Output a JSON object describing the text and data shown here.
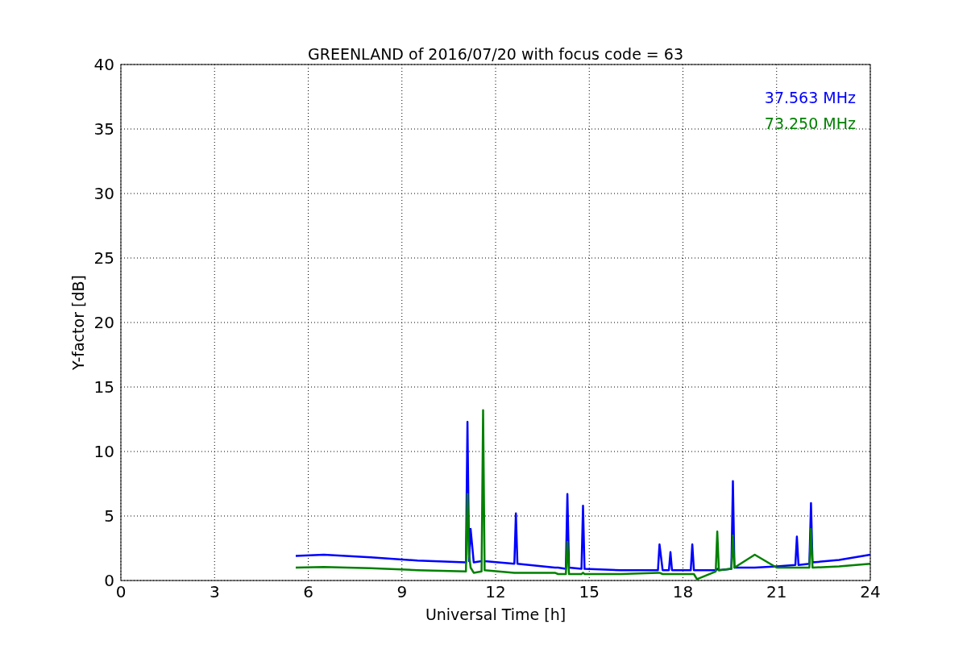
{
  "chart_data": {
    "type": "line",
    "title": "GREENLAND of 2016/07/20 with focus code = 63",
    "xlabel": "Universal Time [h]",
    "ylabel": "Y-factor [dB]",
    "xlim": [
      0,
      24
    ],
    "ylim": [
      0,
      40
    ],
    "xticks": [
      0,
      3,
      6,
      9,
      12,
      15,
      18,
      21,
      24
    ],
    "yticks": [
      0,
      5,
      10,
      15,
      20,
      25,
      30,
      35,
      40
    ],
    "grid": true,
    "x": [
      5.6,
      6.5,
      8.0,
      9.5,
      11.05,
      11.1,
      11.15,
      11.2,
      11.3,
      11.55,
      11.6,
      11.65,
      12.6,
      12.65,
      12.7,
      13.9,
      14.0,
      14.25,
      14.3,
      14.35,
      14.75,
      14.8,
      14.85,
      16,
      17.2,
      17.25,
      17.35,
      17.55,
      17.6,
      17.65,
      18.25,
      18.3,
      18.35,
      18.45,
      19.05,
      19.1,
      19.15,
      19.55,
      19.6,
      19.65,
      20.3,
      21.0,
      21.6,
      21.65,
      21.7,
      22.05,
      22.1,
      22.15,
      23,
      24
    ],
    "series": [
      {
        "name": "37.563 MHz",
        "color": "#0000ff",
        "values": [
          1.9,
          2.0,
          1.8,
          1.55,
          1.4,
          12.3,
          1.5,
          4.0,
          1.4,
          1.5,
          null,
          1.5,
          1.3,
          5.2,
          1.3,
          1.0,
          1.0,
          0.9,
          6.7,
          1.0,
          0.9,
          5.8,
          0.9,
          0.8,
          0.8,
          2.8,
          0.8,
          0.8,
          2.2,
          0.8,
          0.8,
          2.8,
          0.8,
          0.8,
          0.8,
          0.9,
          0.8,
          0.9,
          7.7,
          1.0,
          1.0,
          1.1,
          1.2,
          3.4,
          1.2,
          1.3,
          6.0,
          1.4,
          1.6,
          2.0
        ]
      },
      {
        "name": "73.250 MHz",
        "color": "#008000",
        "values": [
          1.0,
          1.05,
          0.95,
          0.8,
          0.7,
          6.7,
          2.0,
          1.0,
          0.6,
          0.7,
          13.2,
          0.8,
          0.6,
          0.6,
          0.6,
          0.6,
          0.5,
          0.5,
          3.0,
          0.5,
          0.5,
          0.6,
          0.5,
          0.5,
          0.6,
          0.6,
          0.5,
          0.5,
          0.5,
          0.5,
          0.5,
          0.5,
          0.5,
          0.1,
          0.7,
          3.8,
          0.8,
          0.9,
          3.5,
          1.0,
          2.0,
          1.0,
          1.0,
          1.0,
          1.0,
          1.0,
          4.0,
          1.0,
          1.1,
          1.3
        ]
      }
    ]
  }
}
